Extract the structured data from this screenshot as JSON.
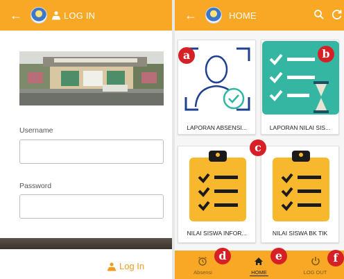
{
  "login": {
    "title": "LOG IN",
    "username_label": "Username",
    "password_label": "Password",
    "username_value": "",
    "password_value": "",
    "submit_label": "Log In"
  },
  "home": {
    "title": "HOME",
    "cards": [
      {
        "label": "LAPORAN ABSENSI..."
      },
      {
        "label": "LAPORAN NILAI SIS..."
      },
      {
        "label": "NILAI SISWA INFOR..."
      },
      {
        "label": "NILAI SISWA BK TIK"
      }
    ],
    "bottom_nav": [
      {
        "label": "Absensi"
      },
      {
        "label": "HOME"
      },
      {
        "label": "LOG OUT"
      }
    ]
  },
  "markers": [
    "a",
    "b",
    "c",
    "d",
    "e",
    "f"
  ],
  "colors": {
    "accent": "#f9a825",
    "marker": "#d71f26",
    "login_text": "#f29b1d"
  }
}
